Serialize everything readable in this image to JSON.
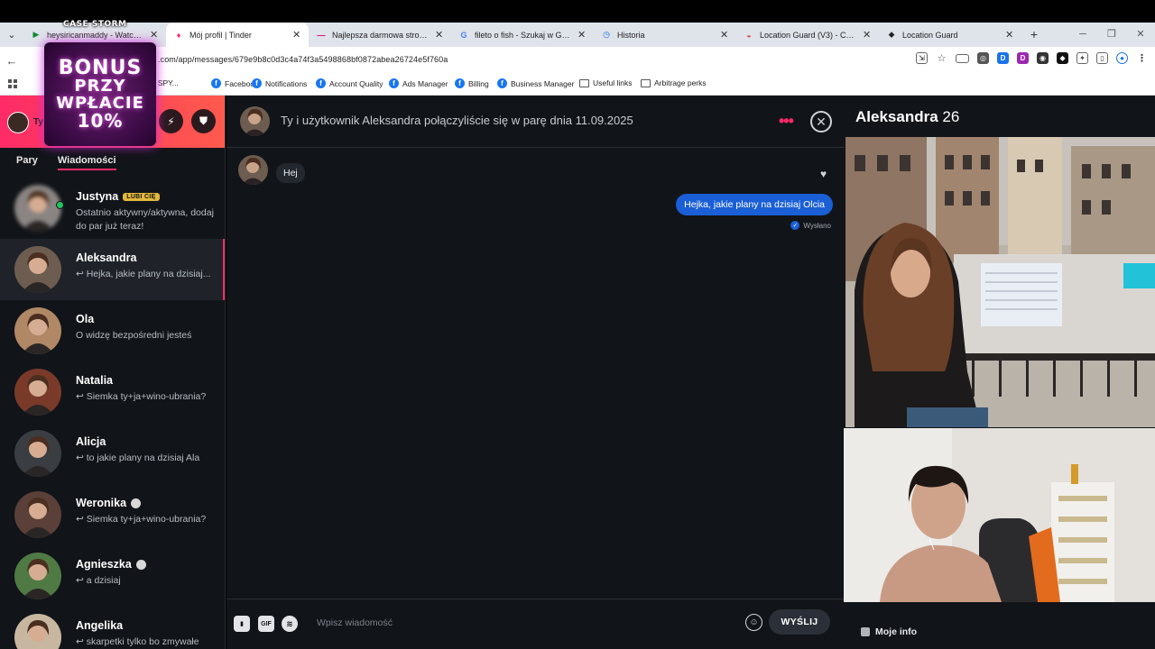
{
  "browser": {
    "tabs": [
      {
        "title": "heysiricanmaddy - Watch Clips",
        "fav_color": "#0d8a2f",
        "fav_glyph": "▶",
        "active": false
      },
      {
        "title": "Mój profil | Tinder",
        "fav_color": "#fd2b67",
        "fav_glyph": "♦",
        "active": true
      },
      {
        "title": "Najlepsza darmowa strona i ap",
        "fav_color": "#e5007e",
        "fav_glyph": "—",
        "active": false
      },
      {
        "title": "fileto o fish - Szukaj w Google",
        "fav_color": "#4285f4",
        "fav_glyph": "G",
        "active": false
      },
      {
        "title": "Historia",
        "fav_color": "#1a73e8",
        "fav_glyph": "◷",
        "active": false
      },
      {
        "title": "Location Guard (V3) - Chrome",
        "fav_color": "#e53935",
        "fav_glyph": "◒",
        "active": false
      },
      {
        "title": "Location Guard",
        "fav_color": "#222222",
        "fav_glyph": "⬥",
        "active": false
      }
    ],
    "url": ".com/app/messages/679e9b8c0d3c4a74f3a5498868bf0872abea26724e5f760a",
    "bookmarks": [
      {
        "label": "ский SPY...",
        "icon": "none"
      },
      {
        "label": "Facebook",
        "icon": "fb"
      },
      {
        "label": "Notifications",
        "icon": "fb"
      },
      {
        "label": "Account Quality",
        "icon": "fb"
      },
      {
        "label": "Ads Manager",
        "icon": "fb"
      },
      {
        "label": "Billing",
        "icon": "fb"
      },
      {
        "label": "Business Manager",
        "icon": "fb"
      },
      {
        "label": "Useful links",
        "icon": "folder"
      },
      {
        "label": "Arbitrage perks",
        "icon": "folder"
      }
    ]
  },
  "overlay": {
    "logo": "CASE STORM",
    "bonus_line1": "BONUS",
    "bonus_line2": "PRZY",
    "bonus_line3": "WPŁACIE",
    "bonus_line4": "10%"
  },
  "sidebar": {
    "user_short": "Ty",
    "tabs": [
      {
        "label": "Pary",
        "active": false
      },
      {
        "label": "Wiadomości",
        "active": true
      }
    ],
    "conversations": [
      {
        "name": "Justyna",
        "badge": "LUBI CIĘ",
        "verified": false,
        "online": true,
        "preview": "Ostatnio aktywny/aktywna, dodaj do par już teraz!",
        "selected": false,
        "avatar_color": "#8a8583"
      },
      {
        "name": "Aleksandra",
        "badge": "",
        "verified": false,
        "online": false,
        "preview": "↩ Hejka, jakie plany na dzisiaj...",
        "selected": true,
        "avatar_color": "#6d5d50"
      },
      {
        "name": "Ola",
        "badge": "",
        "verified": false,
        "online": false,
        "preview": "O widzę bezpośredni jesteś",
        "selected": false,
        "avatar_color": "#b08866"
      },
      {
        "name": "Natalia",
        "badge": "",
        "verified": false,
        "online": false,
        "preview": "↩ Siemka ty+ja+wino-ubrania?",
        "selected": false,
        "avatar_color": "#7a3a2a"
      },
      {
        "name": "Alicja",
        "badge": "",
        "verified": false,
        "online": false,
        "preview": "↩ to jakie plany na dzisiaj Ala",
        "selected": false,
        "avatar_color": "#3a3d42"
      },
      {
        "name": "Weronika",
        "badge": "",
        "verified": true,
        "online": false,
        "preview": "↩ Siemka ty+ja+wino-ubrania?",
        "selected": false,
        "avatar_color": "#5a4038"
      },
      {
        "name": "Agnieszka",
        "badge": "",
        "verified": true,
        "online": false,
        "preview": "↩ a dzisiaj",
        "selected": false,
        "avatar_color": "#4f7a44"
      },
      {
        "name": "Angelika",
        "badge": "",
        "verified": false,
        "online": false,
        "preview": "↩ skarpetki tylko bo zmywałe",
        "selected": false,
        "avatar_color": "#c8b7a0"
      }
    ]
  },
  "chat": {
    "header_title": "Ty i użytkownik Aleksandra połączyliście się w parę dnia 11.09.2025",
    "messages": {
      "incoming": "Hej",
      "outgoing": "Hejka, jakie plany na dzisiaj Olcia",
      "status": "Wysłano"
    },
    "composer": {
      "placeholder": "Wpisz wiadomość",
      "gif_label": "GIF",
      "send_label": "WYŚLIJ"
    }
  },
  "profile": {
    "name": "Aleksandra",
    "age": "26",
    "info_label": "Moje info"
  },
  "colors": {
    "tinder_pink": "#fd2b67",
    "outgoing_bubble": "#1a5fd6",
    "panel_bg": "#111418"
  }
}
